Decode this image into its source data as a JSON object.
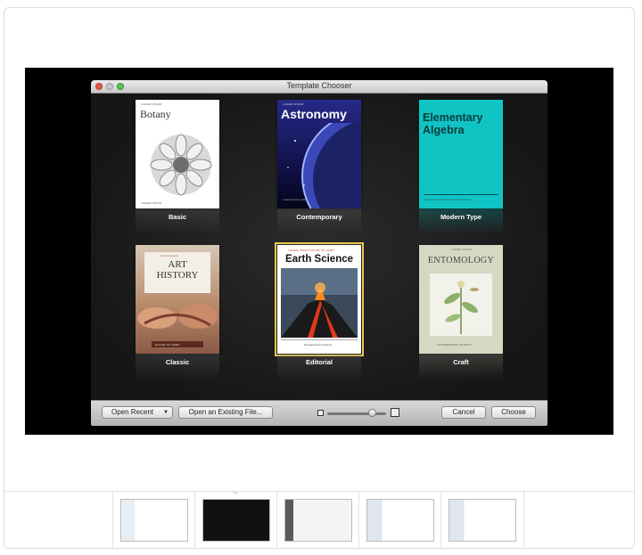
{
  "window": {
    "title": "Template Chooser"
  },
  "templates": [
    {
      "label": "Basic",
      "cover_title": "Botany",
      "cover_top": "LOREM IPSUM",
      "cover_bottom": "LOREM IPSUM"
    },
    {
      "label": "Contemporary",
      "cover_title": "Astronomy",
      "cover_top": "LOREM IPSUM",
      "cover_bottom": "Lorem Ipsum Amet"
    },
    {
      "label": "Modern Type",
      "cover_title": "Elementary Algebra",
      "cover_top": "",
      "cover_bottom": "Lorem Ipsum Dolor Amet Praesent"
    },
    {
      "label": "Classic",
      "cover_title": "ART HISTORY",
      "cover_top": "Lorem Ipsum",
      "cover_bottom": "DOLOR SIT AMET"
    },
    {
      "label": "Editorial",
      "cover_title": "Earth Science",
      "cover_top": "LOREM IPSUM DOLOR SIT AMET",
      "cover_bottom": "Suspendisse Potenti"
    },
    {
      "label": "Craft",
      "cover_title": "ENTOMOLOGY",
      "cover_top": "LOREM IPSUM",
      "cover_bottom": "SUSPENDISSE POTENTI"
    }
  ],
  "selected_template": "Editorial",
  "toolbar": {
    "open_recent": "Open Recent",
    "open_existing": "Open an Existing File...",
    "cancel": "Cancel",
    "choose": "Choose",
    "zoom_level": 0.75
  },
  "colors": {
    "selection": "#e7c84c",
    "modern_type_cover": "#10c4c4",
    "astronomy_cover": "#1a1a7a"
  }
}
